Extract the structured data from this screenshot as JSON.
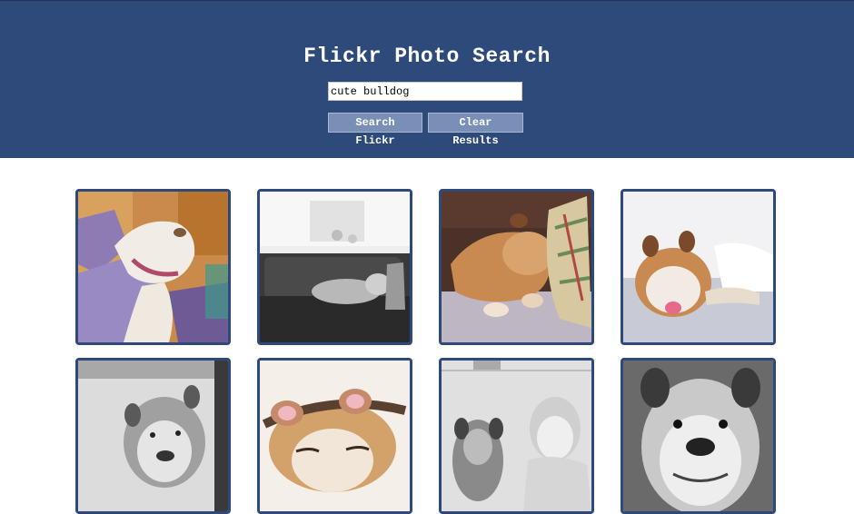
{
  "header": {
    "title": "Flickr Photo Search",
    "search_value": "cute bulldog",
    "search_button_label": "Search Flickr",
    "clear_button_label": "Clear Results"
  },
  "colors": {
    "header_bg": "#2e4a7a",
    "button_bg": "#7a8fb5",
    "tile_border": "#2e4a7a"
  },
  "results": [
    {
      "icon": "bulldog-watercolor-painting"
    },
    {
      "icon": "bulldog-on-gray-sofa-bw"
    },
    {
      "icon": "bulldog-sleeping-on-pillow"
    },
    {
      "icon": "bulldog-lying-on-couch"
    },
    {
      "icon": "bulldog-portrait-bw"
    },
    {
      "icon": "bulldog-with-ear-headband"
    },
    {
      "icon": "bulldog-with-child-bw"
    },
    {
      "icon": "bulldog-face-closeup-bw"
    }
  ]
}
